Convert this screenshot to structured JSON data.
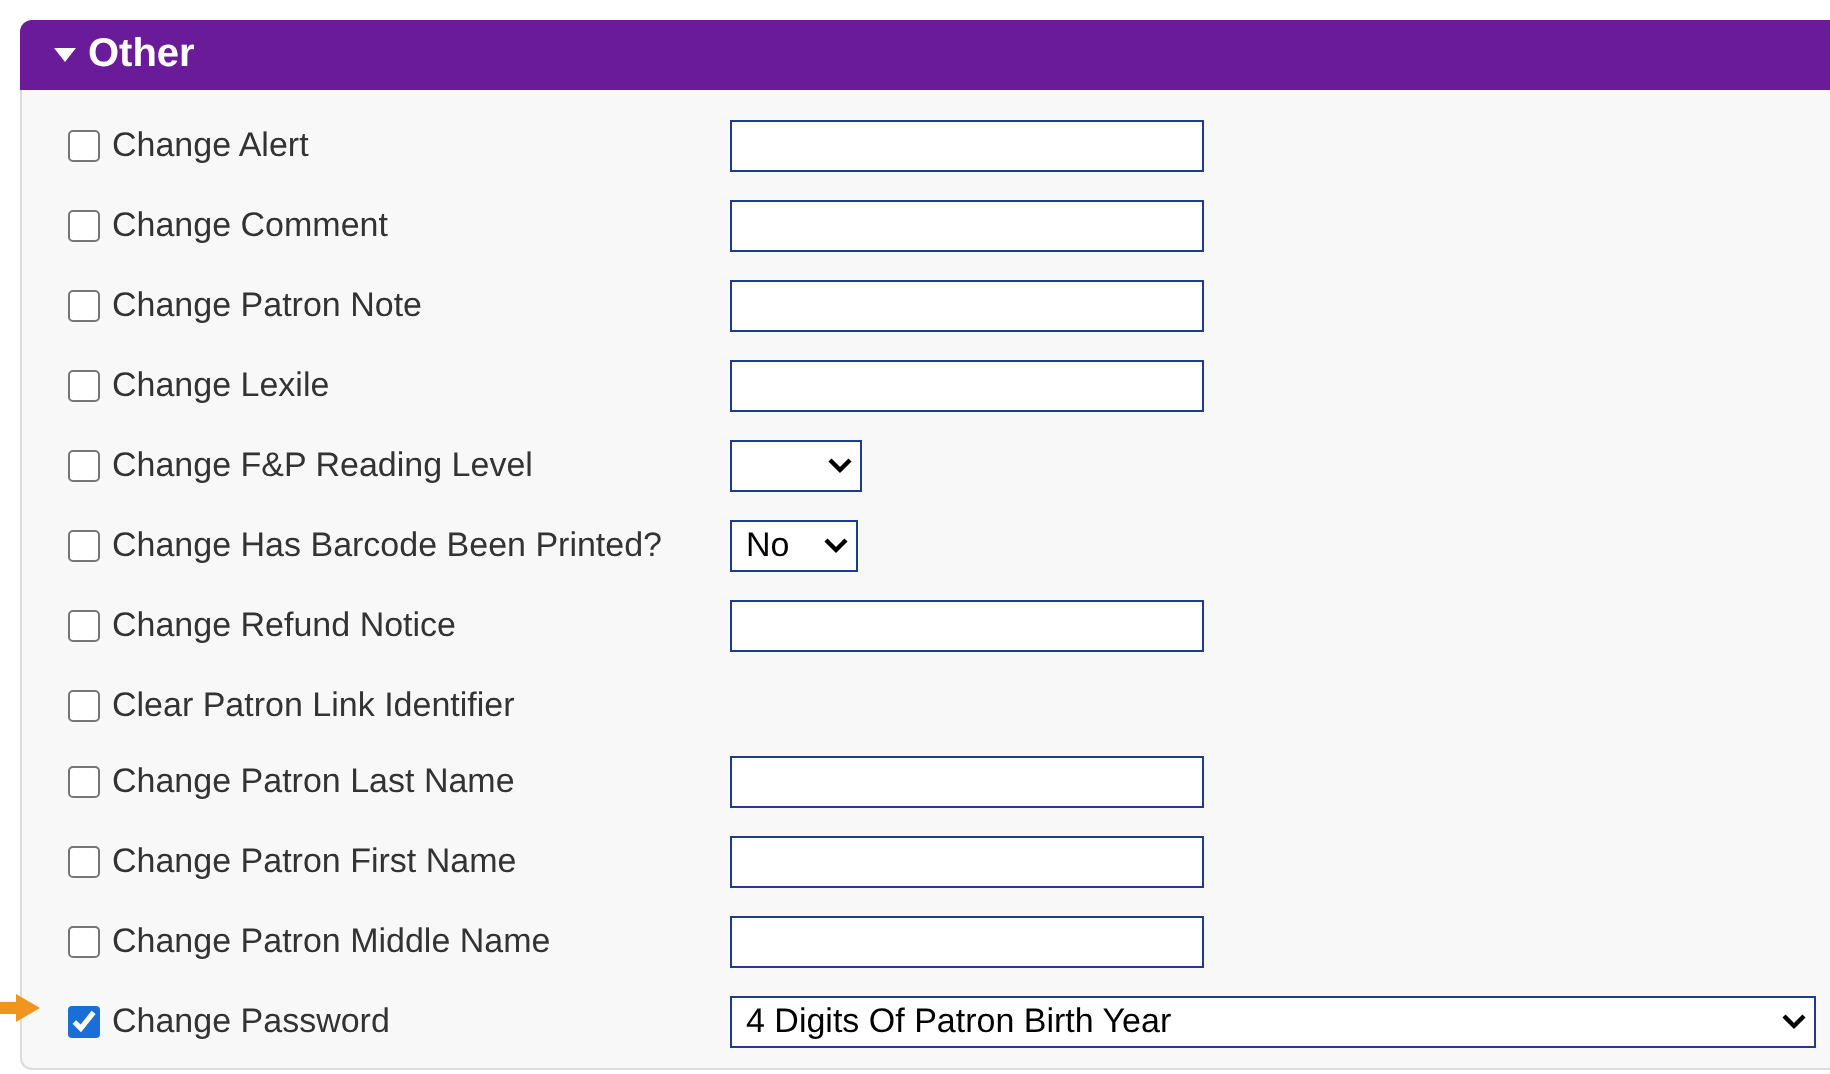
{
  "section": {
    "title": "Other",
    "expanded": true
  },
  "options": [
    {
      "label": "Change Alert",
      "checked": false,
      "kind": "text"
    },
    {
      "label": "Change Comment",
      "checked": false,
      "kind": "text"
    },
    {
      "label": "Change Patron Note",
      "checked": false,
      "kind": "text"
    },
    {
      "label": "Change Lexile",
      "checked": false,
      "kind": "text"
    },
    {
      "label": "Change F&P Reading Level",
      "checked": false,
      "kind": "select"
    },
    {
      "label": "Change Has Barcode Been Printed?",
      "checked": false,
      "kind": "select",
      "value": "No"
    },
    {
      "label": "Change Refund Notice",
      "checked": false,
      "kind": "text"
    },
    {
      "label": "Clear Patron Link Identifier",
      "checked": false,
      "kind": "none"
    },
    {
      "label": "Change Patron Last Name",
      "checked": false,
      "kind": "text"
    },
    {
      "label": "Change Patron First Name",
      "checked": false,
      "kind": "text"
    },
    {
      "label": "Change Patron Middle Name",
      "checked": false,
      "kind": "text"
    },
    {
      "label": "Change Password",
      "checked": true,
      "kind": "wide-select",
      "value": "4 Digits Of Patron Birth Year"
    }
  ]
}
